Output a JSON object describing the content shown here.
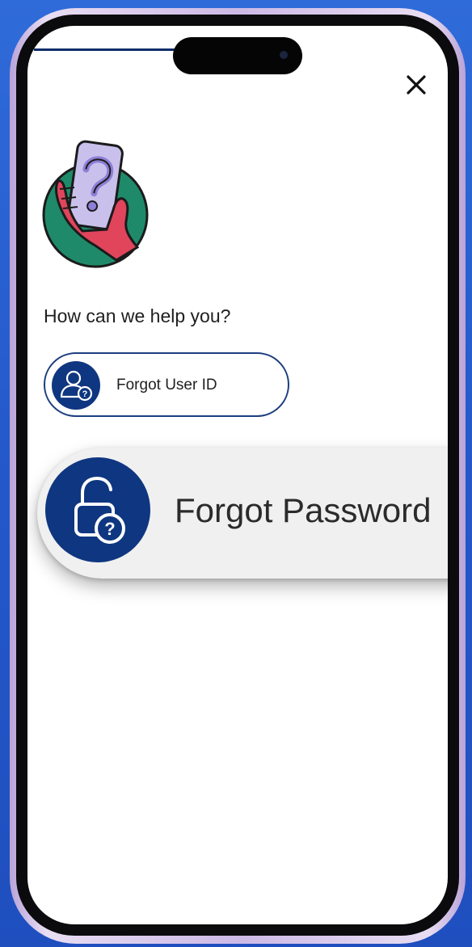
{
  "header": {
    "close_icon": "close-icon"
  },
  "illustration": {
    "icon": "phone-question-illustration"
  },
  "help": {
    "title": "How can we help you?"
  },
  "options": [
    {
      "label": "Forgot User ID",
      "icon": "user-question-icon"
    },
    {
      "label": "Forgot Password",
      "icon": "lock-question-icon"
    }
  ],
  "colors": {
    "accent": "#0f3680",
    "background": "#2458c9",
    "illustration_circle": "#1f8a6a",
    "illustration_hand": "#e0455b",
    "illustration_phone": "#c9c0ec"
  }
}
